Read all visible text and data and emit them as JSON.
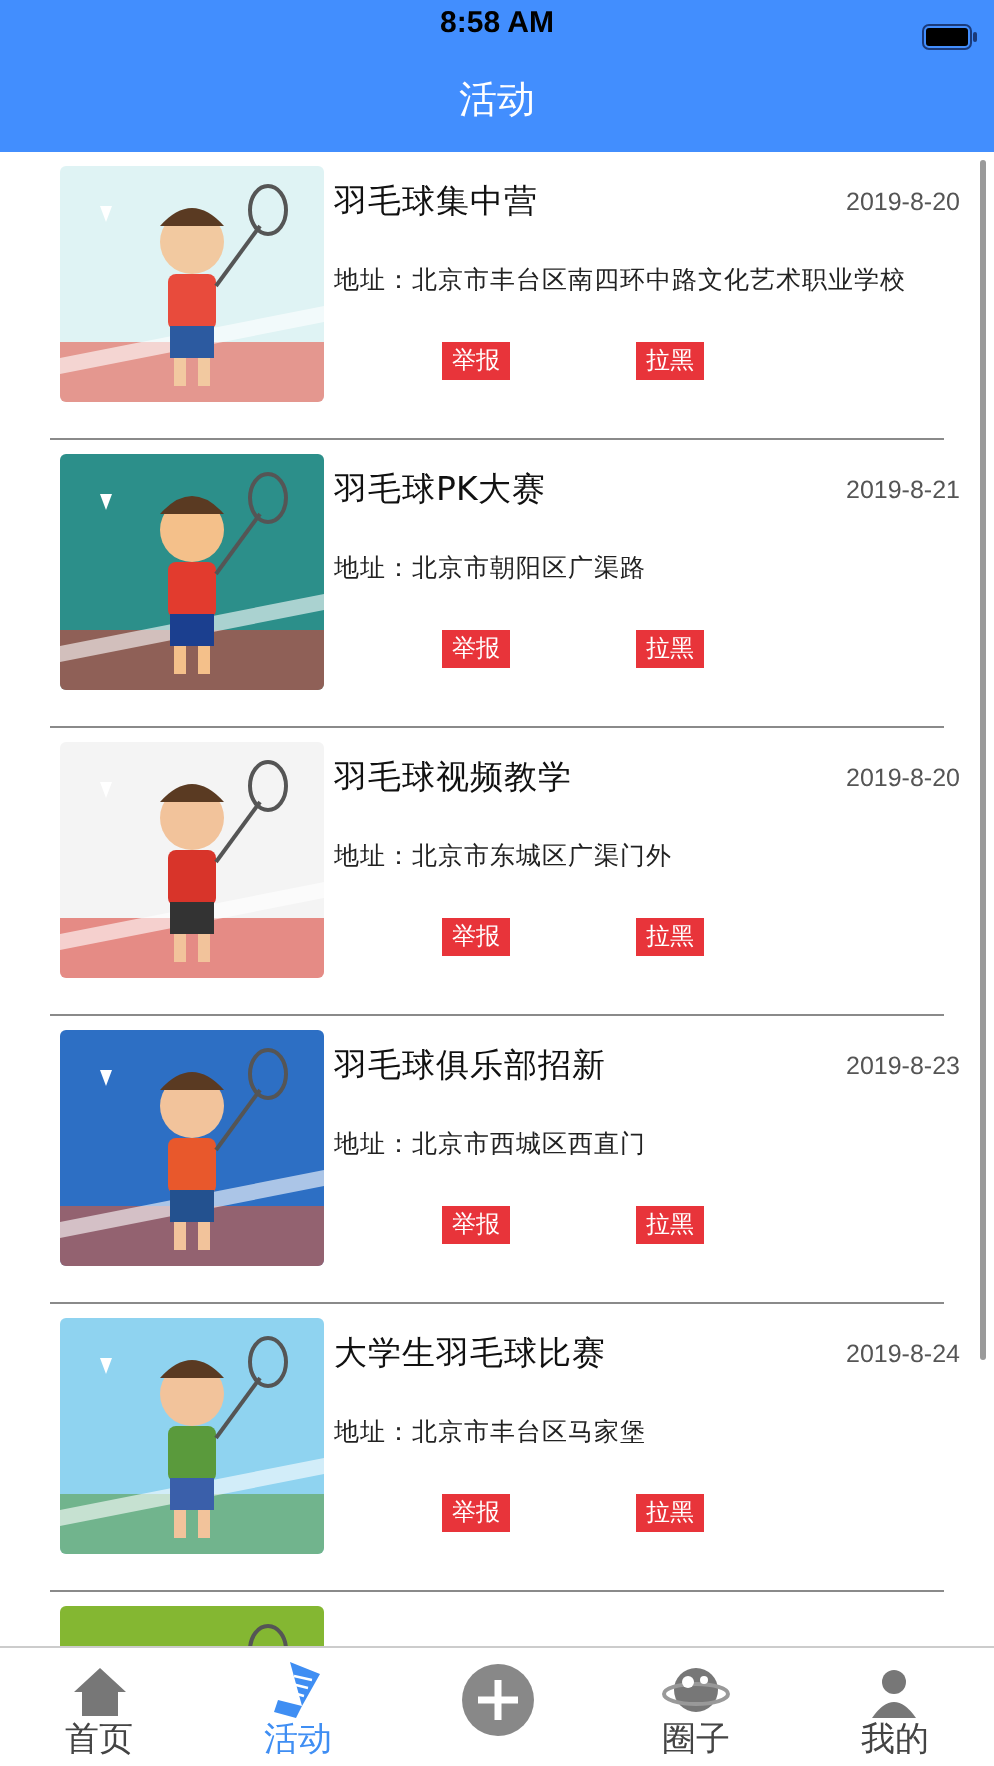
{
  "status_bar": {
    "time": "8:58 AM"
  },
  "nav_bar": {
    "title": "活动"
  },
  "activities": [
    {
      "title": "羽毛球集中营",
      "date": "2019-8-20",
      "address": "地址：北京市丰台区南四环中路文化艺术职业学校",
      "report": "举报",
      "block": "拉黑",
      "kind": "picture"
    },
    {
      "title": "羽毛球PK大赛",
      "date": "2019-8-21",
      "address": "地址：北京市朝阳区广渠路",
      "report": "举报",
      "block": "拉黑",
      "kind": "picture"
    },
    {
      "title": "羽毛球视频教学",
      "date": "2019-8-20",
      "address": "地址：北京市东城区广渠门外",
      "report": "举报",
      "block": "拉黑",
      "kind": "picture"
    },
    {
      "title": "羽毛球俱乐部招新",
      "date": "2019-8-23",
      "address": "地址：北京市西城区西直门",
      "report": "举报",
      "block": "拉黑",
      "kind": "picture"
    },
    {
      "title": "大学生羽毛球比赛",
      "date": "2019-8-24",
      "address": "地址：北京市丰台区马家堡",
      "report": "举报",
      "block": "拉黑",
      "kind": "picture"
    },
    {
      "kind": "picture"
    }
  ],
  "tab_bar": [
    {
      "kind": "home",
      "label": "首页",
      "selected": false
    },
    {
      "kind": "activity",
      "label": "活动",
      "selected": true
    },
    {
      "kind": "add",
      "selected": false
    },
    {
      "kind": "circle",
      "label": "圈子",
      "selected": false
    },
    {
      "kind": "profile",
      "label": "我的",
      "selected": false
    }
  ]
}
